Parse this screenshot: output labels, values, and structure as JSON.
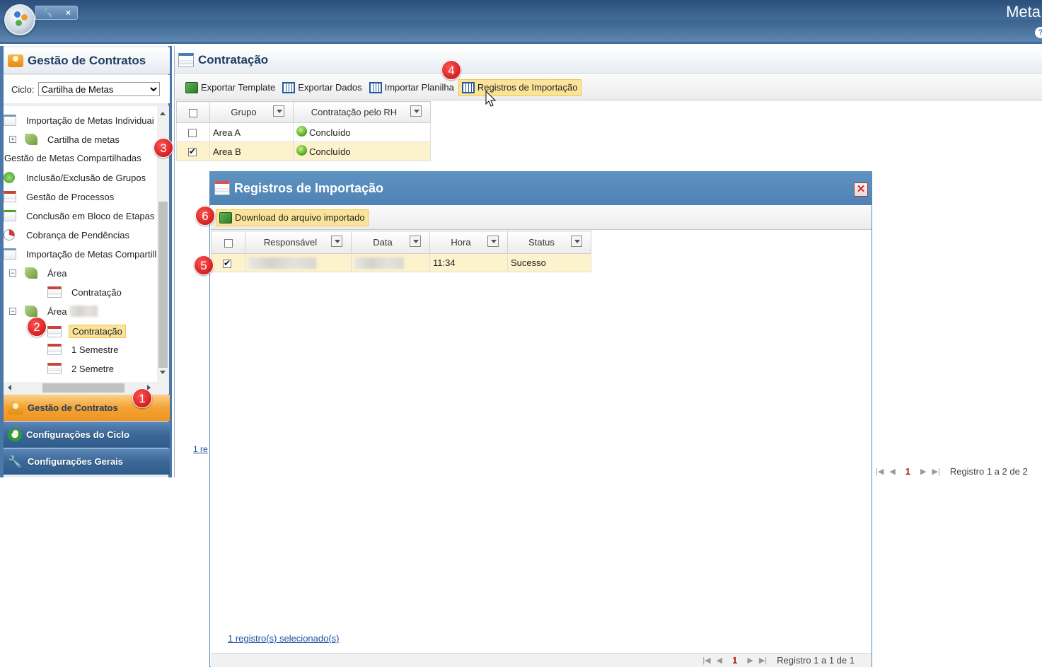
{
  "app": {
    "title": "Meta",
    "help": "?",
    "quick_tools": [
      "🔧",
      "×"
    ]
  },
  "sidebar": {
    "header": "Gestão de Contratos",
    "ciclo_label": "Ciclo:",
    "ciclo_value": "Cartilha de Metas",
    "tree": [
      {
        "label": "Importação de Metas Individuai"
      },
      {
        "label": "Cartilha de metas"
      },
      {
        "label": "Gestão de Metas Compartilhadas"
      },
      {
        "label": "Inclusão/Exclusão de Grupos"
      },
      {
        "label": "Gestão de Processos"
      },
      {
        "label": "Conclusão em Bloco de Etapas"
      },
      {
        "label": "Cobrança de Pendências"
      },
      {
        "label": "Importação de Metas Compartill"
      },
      {
        "label": "Área"
      },
      {
        "label": "Contratação"
      },
      {
        "label": "Área"
      },
      {
        "label": "Contratação"
      },
      {
        "label": "1 Semestre"
      },
      {
        "label": "2 Semetre"
      }
    ],
    "accordion": [
      "Gestão de Contratos",
      "Configurações do Ciclo",
      "Configurações Gerais"
    ]
  },
  "main": {
    "title": "Contratação",
    "toolbar": [
      "Exportar Template",
      "Exportar Dados",
      "Importar Planilha",
      "Registros de Importação"
    ],
    "grid": {
      "columns": [
        "Grupo",
        "Contratação pelo RH"
      ],
      "rows": [
        {
          "grupo": "Area A",
          "status": "Concluído",
          "checked": false
        },
        {
          "grupo": "Area B",
          "status": "Concluído",
          "checked": true
        }
      ]
    },
    "selected_text": "1 re",
    "pager": {
      "page": "1",
      "info": "Registro 1 a 2 de 2"
    }
  },
  "dialog": {
    "title": "Registros de Importação",
    "close": "✕",
    "download_label": "Download do arquivo importado",
    "columns": [
      "Responsável",
      "Data",
      "Hora",
      "Status"
    ],
    "rows": [
      {
        "hora": "11:34",
        "status": "Sucesso",
        "checked": true
      }
    ],
    "selected_text": "1 registro(s) selecionado(s)",
    "pager": {
      "page": "1",
      "info": "Registro 1 a 1 de 1"
    }
  },
  "badges": [
    "1",
    "2",
    "3",
    "4",
    "5",
    "6"
  ]
}
